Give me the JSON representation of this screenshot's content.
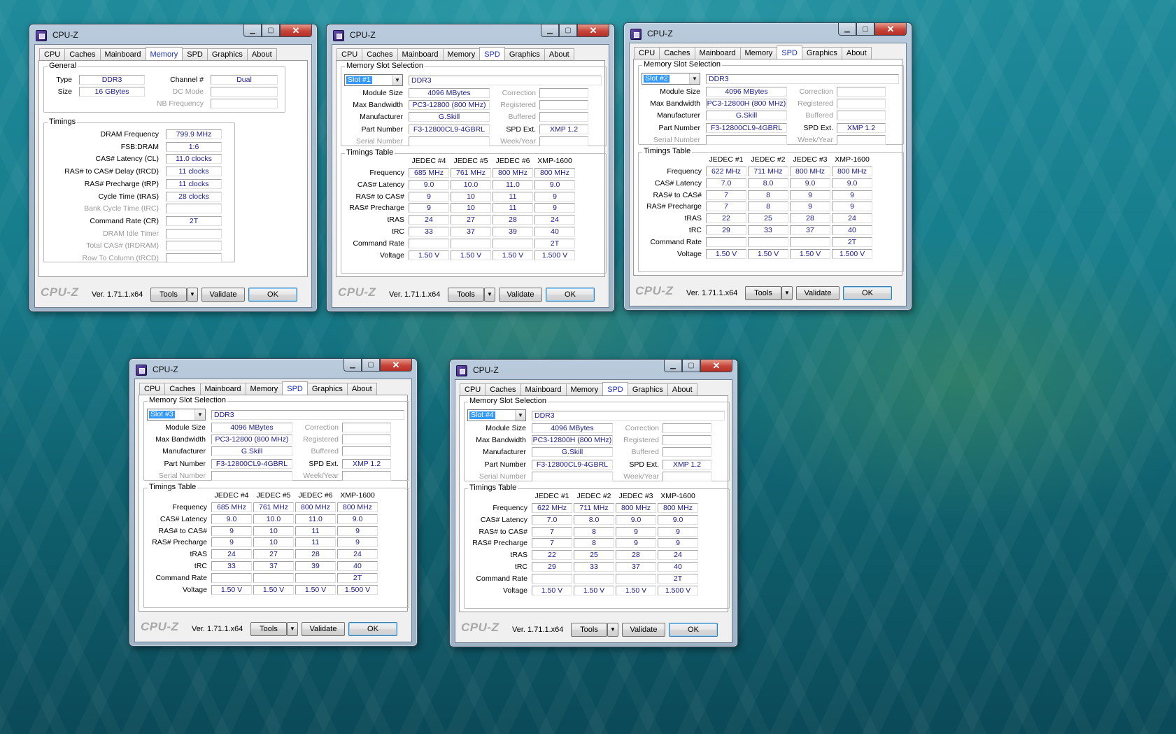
{
  "app": {
    "title": "CPU-Z",
    "version": "Ver. 1.71.1.x64",
    "brand": "CPU-Z",
    "tabs": [
      "CPU",
      "Caches",
      "Mainboard",
      "Memory",
      "SPD",
      "Graphics",
      "About"
    ],
    "buttons": {
      "tools": "Tools",
      "validate": "Validate",
      "ok": "OK"
    },
    "controls": {
      "minimize": "▁",
      "maximize": "▢",
      "close": "✕",
      "dropdown": "▼"
    }
  },
  "memory_window": {
    "active_tab": "Memory",
    "general": {
      "label": "General",
      "type_label": "Type",
      "type": "DDR3",
      "size_label": "Size",
      "size": "16 GBytes",
      "channel_label": "Channel #",
      "channel": "Dual",
      "dc_mode_label": "DC Mode",
      "dc_mode": "",
      "nb_freq_label": "NB Frequency",
      "nb_freq": ""
    },
    "timings": {
      "label": "Timings",
      "rows": [
        {
          "label": "DRAM Frequency",
          "value": "799.9 MHz",
          "dim": false
        },
        {
          "label": "FSB:DRAM",
          "value": "1:6",
          "dim": false
        },
        {
          "label": "CAS# Latency (CL)",
          "value": "11.0 clocks",
          "dim": false
        },
        {
          "label": "RAS# to CAS# Delay (tRCD)",
          "value": "11 clocks",
          "dim": false
        },
        {
          "label": "RAS# Precharge (tRP)",
          "value": "11 clocks",
          "dim": false
        },
        {
          "label": "Cycle Time (tRAS)",
          "value": "28 clocks",
          "dim": false
        },
        {
          "label": "Bank Cycle Time (tRC)",
          "value": "",
          "dim": true
        },
        {
          "label": "Command Rate (CR)",
          "value": "2T",
          "dim": false
        },
        {
          "label": "DRAM Idle Timer",
          "value": "",
          "dim": true
        },
        {
          "label": "Total CAS# (tRDRAM)",
          "value": "",
          "dim": true
        },
        {
          "label": "Row To Column (tRCD)",
          "value": "",
          "dim": true
        }
      ]
    }
  },
  "spd_labels": {
    "slot_group": "Memory Slot Selection",
    "module_size": "Module Size",
    "max_bandwidth": "Max Bandwidth",
    "manufacturer": "Manufacturer",
    "part_number": "Part Number",
    "serial_number": "Serial Number",
    "correction": "Correction",
    "registered": "Registered",
    "buffered": "Buffered",
    "spd_ext": "SPD Ext.",
    "week_year": "Week/Year",
    "timings_table": "Timings Table",
    "rows": [
      "Frequency",
      "CAS# Latency",
      "RAS# to CAS#",
      "RAS# Precharge",
      "tRAS",
      "tRC",
      "Command Rate",
      "Voltage"
    ]
  },
  "spd_windows": [
    {
      "slot": "Slot #1",
      "type": "DDR3",
      "module_size": "4096 MBytes",
      "max_bandwidth": "PC3-12800 (800 MHz)",
      "manufacturer": "G.Skill",
      "part_number": "F3-12800CL9-4GBRL",
      "spd_ext": "XMP 1.2",
      "columns": [
        "JEDEC #4",
        "JEDEC #5",
        "JEDEC #6",
        "XMP-1600"
      ],
      "table": [
        [
          "685 MHz",
          "761 MHz",
          "800 MHz",
          "800 MHz"
        ],
        [
          "9.0",
          "10.0",
          "11.0",
          "9.0"
        ],
        [
          "9",
          "10",
          "11",
          "9"
        ],
        [
          "9",
          "10",
          "11",
          "9"
        ],
        [
          "24",
          "27",
          "28",
          "24"
        ],
        [
          "33",
          "37",
          "39",
          "40"
        ],
        [
          "",
          "",
          "",
          "2T"
        ],
        [
          "1.50 V",
          "1.50 V",
          "1.50 V",
          "1.500 V"
        ]
      ]
    },
    {
      "slot": "Slot #2",
      "type": "DDR3",
      "module_size": "4096 MBytes",
      "max_bandwidth": "PC3-12800H (800 MHz)",
      "manufacturer": "G.Skill",
      "part_number": "F3-12800CL9-4GBRL",
      "spd_ext": "XMP 1.2",
      "columns": [
        "JEDEC #1",
        "JEDEC #2",
        "JEDEC #3",
        "XMP-1600"
      ],
      "table": [
        [
          "622 MHz",
          "711 MHz",
          "800 MHz",
          "800 MHz"
        ],
        [
          "7.0",
          "8.0",
          "9.0",
          "9.0"
        ],
        [
          "7",
          "8",
          "9",
          "9"
        ],
        [
          "7",
          "8",
          "9",
          "9"
        ],
        [
          "22",
          "25",
          "28",
          "24"
        ],
        [
          "29",
          "33",
          "37",
          "40"
        ],
        [
          "",
          "",
          "",
          "2T"
        ],
        [
          "1.50 V",
          "1.50 V",
          "1.50 V",
          "1.500 V"
        ]
      ]
    },
    {
      "slot": "Slot #3",
      "type": "DDR3",
      "module_size": "4096 MBytes",
      "max_bandwidth": "PC3-12800 (800 MHz)",
      "manufacturer": "G.Skill",
      "part_number": "F3-12800CL9-4GBRL",
      "spd_ext": "XMP 1.2",
      "columns": [
        "JEDEC #4",
        "JEDEC #5",
        "JEDEC #6",
        "XMP-1600"
      ],
      "table": [
        [
          "685 MHz",
          "761 MHz",
          "800 MHz",
          "800 MHz"
        ],
        [
          "9.0",
          "10.0",
          "11.0",
          "9.0"
        ],
        [
          "9",
          "10",
          "11",
          "9"
        ],
        [
          "9",
          "10",
          "11",
          "9"
        ],
        [
          "24",
          "27",
          "28",
          "24"
        ],
        [
          "33",
          "37",
          "39",
          "40"
        ],
        [
          "",
          "",
          "",
          "2T"
        ],
        [
          "1.50 V",
          "1.50 V",
          "1.50 V",
          "1.500 V"
        ]
      ]
    },
    {
      "slot": "Slot #4",
      "type": "DDR3",
      "module_size": "4096 MBytes",
      "max_bandwidth": "PC3-12800H (800 MHz)",
      "manufacturer": "G.Skill",
      "part_number": "F3-12800CL9-4GBRL",
      "spd_ext": "XMP 1.2",
      "columns": [
        "JEDEC #1",
        "JEDEC #2",
        "JEDEC #3",
        "XMP-1600"
      ],
      "table": [
        [
          "622 MHz",
          "711 MHz",
          "800 MHz",
          "800 MHz"
        ],
        [
          "7.0",
          "8.0",
          "9.0",
          "9.0"
        ],
        [
          "7",
          "8",
          "9",
          "9"
        ],
        [
          "7",
          "8",
          "9",
          "9"
        ],
        [
          "22",
          "25",
          "28",
          "24"
        ],
        [
          "29",
          "33",
          "37",
          "40"
        ],
        [
          "",
          "",
          "",
          "2T"
        ],
        [
          "1.50 V",
          "1.50 V",
          "1.50 V",
          "1.500 V"
        ]
      ]
    }
  ]
}
